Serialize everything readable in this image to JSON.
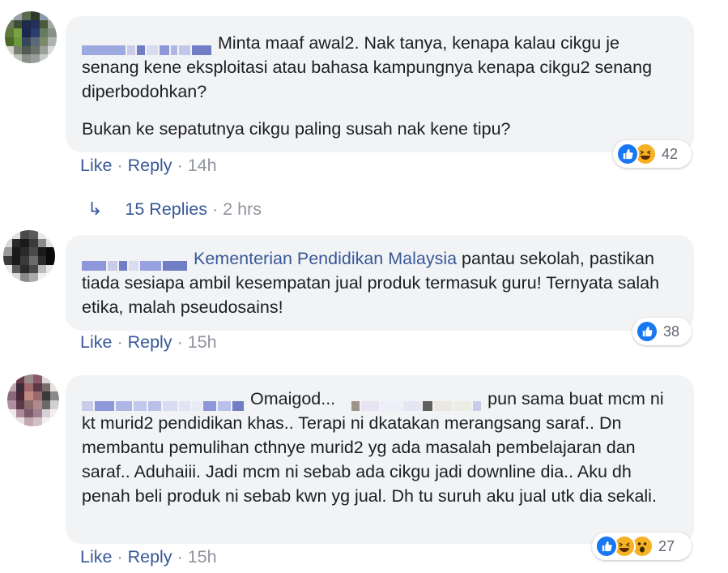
{
  "comments": [
    {
      "text_paragraphs": [
        "Minta maaf awal2. Nak tanya, kenapa kalau cikgu je senang kene eksploitasi atau bahasa kampungnya kenapa cikgu2 senang diperbodohkan?",
        "Bukan ke sepatutnya cikgu paling susah nak kene tipu?"
      ],
      "like_label": "Like",
      "reply_label": "Reply",
      "timestamp": "14h",
      "reaction_count": "42",
      "reactions": [
        "like-icon",
        "haha-icon"
      ]
    },
    {
      "mention": "Kementerian Pendidikan Malaysia",
      "text_after_mention": " pantau sekolah, pastikan tiada sesiapa ambil kesempatan jual produk termasuk guru! Ternyata salah etika, malah pseudosains!",
      "like_label": "Like",
      "reply_label": "Reply",
      "timestamp": "15h",
      "reaction_count": "38",
      "reactions": [
        "like-icon"
      ]
    },
    {
      "text_start": "Omaigod...",
      "text_mid": "pun",
      "text_rest": "sama buat mcm ni kt murid2 pendidikan khas.. Terapi ni dkatakan merangsang saraf.. Dn membantu pemulihan cthnye murid2 yg ada masalah pembelajaran dan saraf.. Aduhaiii. Jadi mcm ni sebab ada cikgu jadi downline dia.. Aku dh penah beli produk ni sebab kwn yg jual. Dh tu suruh aku jual utk dia sekali.",
      "like_label": "Like",
      "reply_label": "Reply",
      "timestamp": "15h",
      "reaction_count": "27",
      "reactions": [
        "like-icon",
        "haha-icon",
        "wow-icon"
      ]
    }
  ],
  "replies_thread": {
    "label": "15 Replies",
    "timestamp": "2 hrs",
    "separator": "·"
  },
  "separator": "·",
  "colors": {
    "bubble_bg": "#f2f3f5",
    "link": "#385898",
    "meta": "#90949c",
    "like_blue": "#1877f2",
    "emoji_yellow": "#f7b125"
  }
}
